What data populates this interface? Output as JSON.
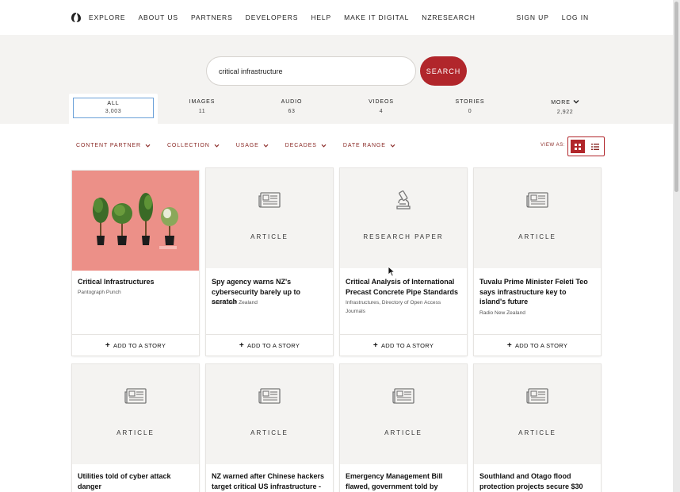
{
  "nav": {
    "left": [
      "EXPLORE",
      "ABOUT US",
      "PARTNERS",
      "DEVELOPERS",
      "HELP",
      "MAKE IT DIGITAL",
      "NZRESEARCH"
    ],
    "right": [
      "SIGN UP",
      "LOG IN"
    ]
  },
  "search": {
    "value": "critical infrastructure",
    "button": "SEARCH"
  },
  "tabs": [
    {
      "label": "ALL",
      "count": "3,003"
    },
    {
      "label": "IMAGES",
      "count": "11"
    },
    {
      "label": "AUDIO",
      "count": "63"
    },
    {
      "label": "VIDEOS",
      "count": "4"
    },
    {
      "label": "STORIES",
      "count": "0"
    },
    {
      "label": "MORE",
      "count": "2,922"
    }
  ],
  "filters": [
    "CONTENT PARTNER",
    "COLLECTION",
    "USAGE",
    "DECADES",
    "DATE RANGE"
  ],
  "view_as": "VIEW AS:",
  "colors": {
    "accent": "#b1262b",
    "active_tab_border": "#6aa0d8",
    "thumb_pink": "#ec9088"
  },
  "cards": [
    {
      "type": "",
      "title": "Critical Infrastructures",
      "sub": "Pantograph Punch",
      "icon": "plants-image",
      "footer": "ADD TO A STORY"
    },
    {
      "type": "ARTICLE",
      "title": "Spy agency warns NZ's cybersecurity barely up to scratch",
      "sub": "Radio New Zealand",
      "icon": "newspaper-icon",
      "footer": "ADD TO A STORY"
    },
    {
      "type": "RESEARCH PAPER",
      "title": "Critical Analysis of International Precast Concrete Pipe Standards",
      "sub": "Infrastructures, Directory of Open Access Journals",
      "icon": "microscope-icon",
      "footer": "ADD TO A STORY"
    },
    {
      "type": "ARTICLE",
      "title": "Tuvalu Prime Minister Feleti Teo says infrastructure key to island's future",
      "sub": "Radio New Zealand",
      "icon": "newspaper-icon",
      "footer": "ADD TO A STORY"
    },
    {
      "type": "ARTICLE",
      "title": "Utilities told of cyber attack danger",
      "sub": "",
      "icon": "newspaper-icon",
      "footer": ""
    },
    {
      "type": "ARTICLE",
      "title": "NZ warned after Chinese hackers target critical US infrastructure -",
      "sub": "",
      "icon": "newspaper-icon",
      "footer": ""
    },
    {
      "type": "ARTICLE",
      "title": "Emergency Management Bill flawed, government told by",
      "sub": "",
      "icon": "newspaper-icon",
      "footer": ""
    },
    {
      "type": "ARTICLE",
      "title": "Southland and Otago flood protection projects secure $30",
      "sub": "",
      "icon": "newspaper-icon",
      "footer": ""
    }
  ]
}
